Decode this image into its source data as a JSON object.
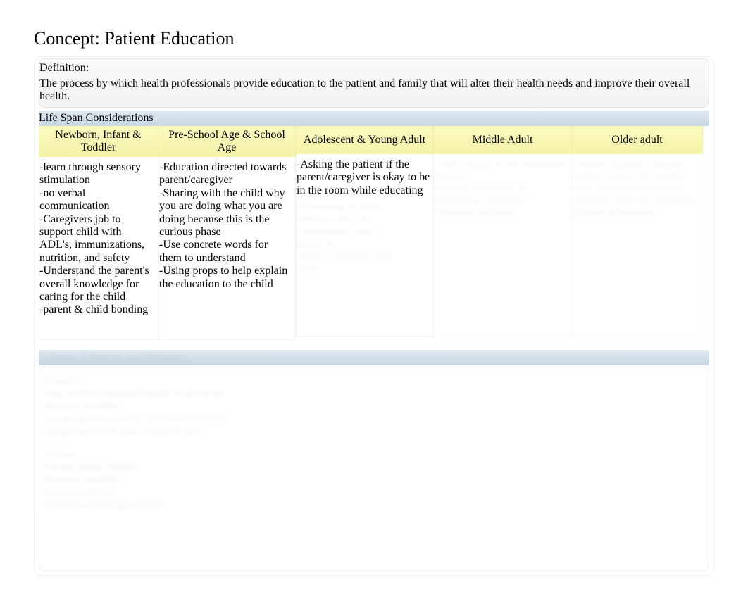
{
  "title": "Concept: Patient Education",
  "definition": {
    "label": "Definition:",
    "text": "The process by which health professionals provide education to the patient and family that will alter their health needs and improve their overall health."
  },
  "lifespan_header": "Life Span Considerations",
  "columns": [
    {
      "header": "Newborn, Infant & Toddler",
      "body": "-learn through sensory stimulation\n-no verbal communication\n-Caregivers job to support child with ADL's, immunizations, nutrition, and safety\n-Understand the parent's overall knowledge for caring for the child\n-parent & child bonding"
    },
    {
      "header": "Pre-School Age & School Age",
      "body": "-Education directed towards parent/caregiver\n-Sharing with the child why you are doing what you are doing because this is the curious phase\n-Use concrete words for them to understand\n-Using props to help explain the education to the child"
    },
    {
      "header": "Adolescent & Young Adult",
      "body_clear": "-Asking the patient if the parent/caregiver is okay to be in the room while educating",
      "body_blur": "-Explaining in more\ndetail so they can\ncomprehend what is\ngoing on\n-Refer to websites and\napps"
    },
    {
      "header": "Middle Adult",
      "body_blur": "-Fully engage in the education process\n-Provide resources for continuing education\n-Promote wellness"
    },
    {
      "header": "Older adult",
      "body_blur": "-Assess cognitive function\n-Speak slowly and clearly\n-Use larger print materials\n-Involve family or caregivers\n-Repeat information"
    }
  ],
  "second_section_header": "Cultural, Ethnicity, and Religion:",
  "bottom_blocks": [
    "Hispanic:\n-May involve extended family in decisions\n-Respect for elders\n-Language barriers may require interpreters\n-Religious beliefs may influence care",
    "African:\n-Strong family support\n-Respect for elders\n-Spiritual beliefs\n-Traditional healing practices"
  ]
}
